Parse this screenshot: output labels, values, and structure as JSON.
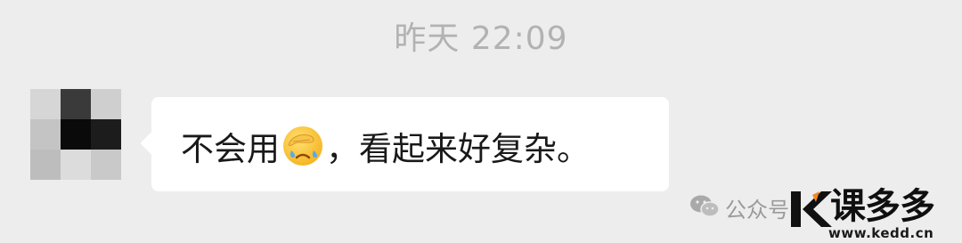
{
  "chat": {
    "timestamp": "昨天 22:09",
    "message": {
      "text_before": "不会用",
      "emoji": "face-palm-emoji",
      "text_after": "，看起来好复杂。"
    }
  },
  "watermark": {
    "wechat_label": "公众号",
    "brand_name": "课多多",
    "brand_url": "www.kedd.cn"
  },
  "colors": {
    "background": "#ededed",
    "bubble": "#ffffff",
    "text": "#191919",
    "timestamp": "#b2b2b2",
    "logo_orange": "#f08a24"
  }
}
